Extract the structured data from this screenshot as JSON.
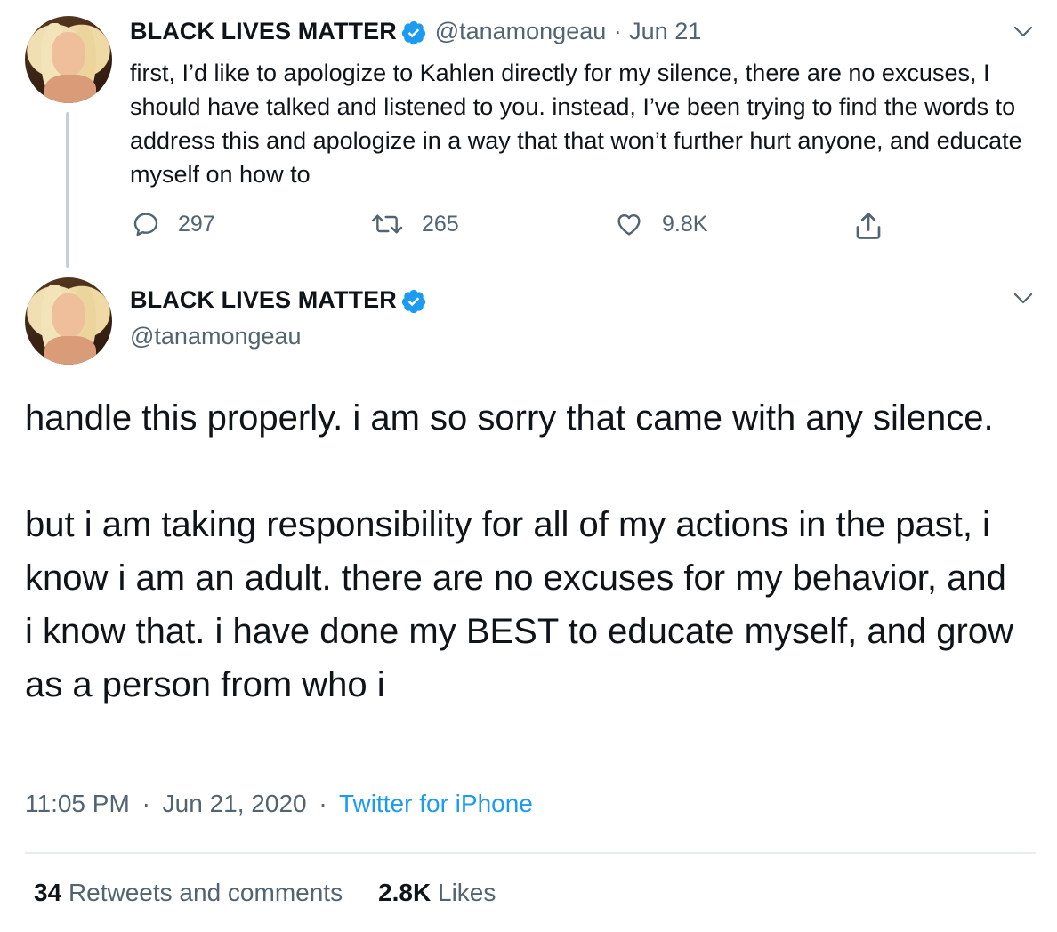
{
  "tweet1": {
    "display_name": "BLACK LIVES MATTER",
    "handle": "@tanamongeau",
    "separator": "·",
    "date": "Jun 21",
    "text": "first, I’d like to apologize to Kahlen directly for my silence, there are no excuses, I should have talked and listened to you. instead, I’ve been trying to find the words to address this and apologize in a way that that won’t further hurt anyone, and educate myself on how to",
    "replies": "297",
    "retweets": "265",
    "likes": "9.8K"
  },
  "tweet2": {
    "display_name": "BLACK LIVES MATTER",
    "handle": "@tanamongeau",
    "text": "handle this properly. i am so sorry that came with any silence.\n\nbut i am taking responsibility for all of my actions in the past, i know i am an adult. there are no excuses for my behavior, and i know that. i have done my BEST to educate myself, and grow as a person from who i",
    "time": "11:05 PM",
    "separator": "·",
    "date": "Jun 21, 2020",
    "source": "Twitter for iPhone",
    "retweets_count": "34",
    "retweets_label": "Retweets and comments",
    "likes_count": "2.8K",
    "likes_label": "Likes"
  },
  "colors": {
    "text": "#0f1419",
    "secondary": "#536471",
    "accent": "#1d9bf0",
    "divider": "#e6ecf0",
    "thread_line": "#c4cfd6"
  },
  "icons": [
    "verified-badge-icon",
    "chevron-down-icon",
    "reply-icon",
    "retweet-icon",
    "like-icon",
    "share-icon"
  ]
}
